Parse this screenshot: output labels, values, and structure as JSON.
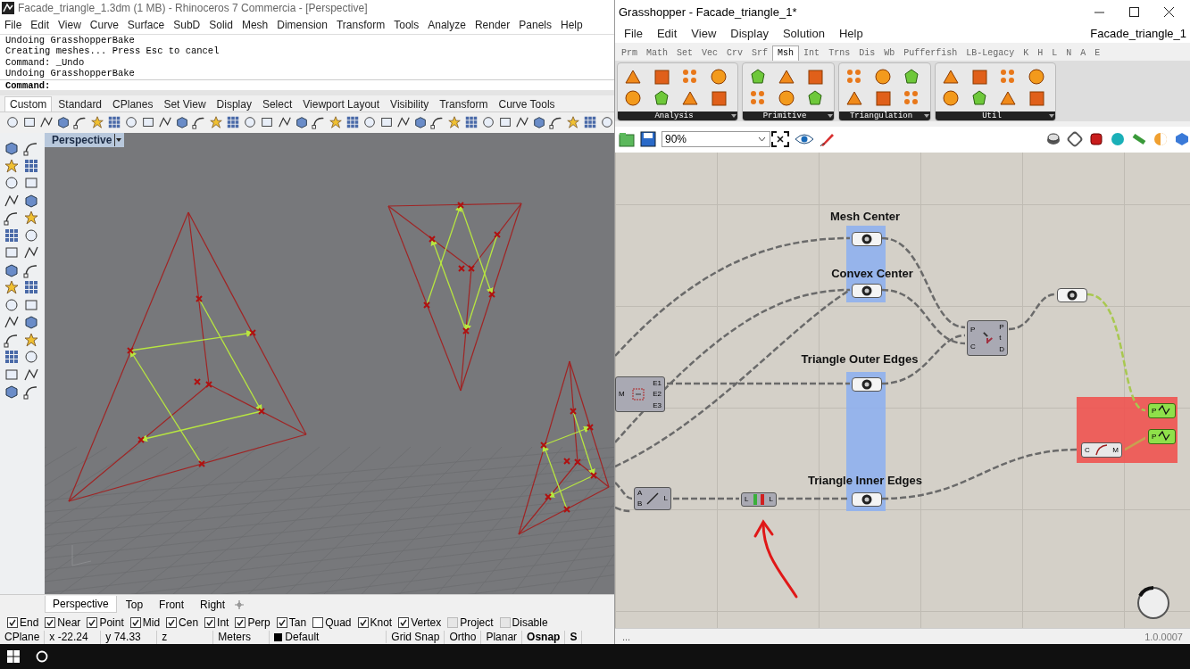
{
  "rhino": {
    "title": "Facade_triangle_1.3dm (1 MB) - Rhinoceros 7 Commercia - [Perspective]",
    "menu": [
      "File",
      "Edit",
      "View",
      "Curve",
      "Surface",
      "SubD",
      "Solid",
      "Mesh",
      "Dimension",
      "Transform",
      "Tools",
      "Analyze",
      "Render",
      "Panels",
      "Help"
    ],
    "command_history": [
      "Undoing GrasshopperBake",
      "Creating meshes... Press Esc to cancel",
      "Command: _Undo",
      "Undoing GrasshopperBake"
    ],
    "command_prompt": "Command:",
    "toolbar_tabs": [
      {
        "label": "Custom",
        "selected": true
      },
      {
        "label": "Standard",
        "selected": false
      },
      {
        "label": "CPlanes",
        "selected": false
      },
      {
        "label": "Set View",
        "selected": false
      },
      {
        "label": "Display",
        "selected": false
      },
      {
        "label": "Select",
        "selected": false
      },
      {
        "label": "Viewport Layout",
        "selected": false
      },
      {
        "label": "Visibility",
        "selected": false
      },
      {
        "label": "Transform",
        "selected": false
      },
      {
        "label": "Curve Tools",
        "selected": false
      }
    ],
    "viewport": {
      "label": "Perspective"
    },
    "viewport_tabs": [
      {
        "label": "Perspective",
        "selected": true
      },
      {
        "label": "Top",
        "selected": false
      },
      {
        "label": "Front",
        "selected": false
      },
      {
        "label": "Right",
        "selected": false
      }
    ],
    "osnaps": [
      {
        "label": "End",
        "checked": true,
        "disabled": false
      },
      {
        "label": "Near",
        "checked": true,
        "disabled": false
      },
      {
        "label": "Point",
        "checked": true,
        "disabled": false
      },
      {
        "label": "Mid",
        "checked": true,
        "disabled": false
      },
      {
        "label": "Cen",
        "checked": true,
        "disabled": false
      },
      {
        "label": "Int",
        "checked": true,
        "disabled": false
      },
      {
        "label": "Perp",
        "checked": true,
        "disabled": false
      },
      {
        "label": "Tan",
        "checked": true,
        "disabled": false
      },
      {
        "label": "Quad",
        "checked": false,
        "disabled": false
      },
      {
        "label": "Knot",
        "checked": true,
        "disabled": false
      },
      {
        "label": "Vertex",
        "checked": true,
        "disabled": false
      },
      {
        "label": "Project",
        "checked": false,
        "disabled": true
      },
      {
        "label": "Disable",
        "checked": false,
        "disabled": true
      }
    ],
    "status_fields": [
      "CPlane",
      "x -22.24",
      "y 74.33",
      "z",
      "Meters"
    ],
    "layer": "Default",
    "toggles": [
      {
        "label": "Grid Snap",
        "on": false
      },
      {
        "label": "Ortho",
        "on": false
      },
      {
        "label": "Planar",
        "on": false
      },
      {
        "label": "Osnap",
        "on": true
      },
      {
        "label": "S",
        "on": true
      }
    ]
  },
  "grasshopper": {
    "title": "Grasshopper - Facade_triangle_1*",
    "menu": [
      "File",
      "Edit",
      "View",
      "Display",
      "Solution",
      "Help"
    ],
    "document_name": "Facade_triangle_1",
    "tabs": [
      {
        "label": "Prm",
        "selected": false
      },
      {
        "label": "Math",
        "selected": false
      },
      {
        "label": "Set",
        "selected": false
      },
      {
        "label": "Vec",
        "selected": false
      },
      {
        "label": "Crv",
        "selected": false
      },
      {
        "label": "Srf",
        "selected": false
      },
      {
        "label": "Msh",
        "selected": true
      },
      {
        "label": "Int",
        "selected": false
      },
      {
        "label": "Trns",
        "selected": false
      },
      {
        "label": "Dis",
        "selected": false
      },
      {
        "label": "Wb",
        "selected": false
      },
      {
        "label": "Pufferfish",
        "selected": false
      },
      {
        "label": "LB-Legacy",
        "selected": false
      },
      {
        "label": "K",
        "selected": false
      },
      {
        "label": "H",
        "selected": false
      },
      {
        "label": "L",
        "selected": false
      },
      {
        "label": "N",
        "selected": false
      },
      {
        "label": "A",
        "selected": false
      },
      {
        "label": "E",
        "selected": false
      }
    ],
    "panels": [
      "Analysis",
      "Primitive",
      "Triangulation",
      "Util"
    ],
    "zoom": "90%",
    "scribbles": [
      "Mesh Center",
      "Convex Center",
      "Triangle Outer Edges",
      "Triangle Inner Edges"
    ],
    "components": [
      {
        "kind": "mesh_edges",
        "selected": false,
        "inputs": [
          "M"
        ],
        "outputs": [
          "E1",
          "E2",
          "E3"
        ]
      },
      {
        "kind": "evaluate",
        "selected": false,
        "inputs": [
          "P",
          "C"
        ],
        "outputs": [
          "P",
          "t",
          "D"
        ]
      },
      {
        "kind": "line",
        "selected": false,
        "inputs": [
          "A",
          "B"
        ],
        "outputs": [
          "L"
        ]
      },
      {
        "kind": "list",
        "selected": false,
        "inputs": [
          "L"
        ],
        "outputs": [
          "L"
        ]
      },
      {
        "kind": "curve",
        "selected": false,
        "inputs": [
          "C"
        ],
        "outputs": [
          "M"
        ]
      },
      {
        "kind": "preview",
        "selected": true,
        "inputs": [
          "P"
        ]
      },
      {
        "kind": "preview",
        "selected": true,
        "inputs": [
          "P"
        ]
      }
    ],
    "status": "...",
    "version": "1.0.0007"
  }
}
